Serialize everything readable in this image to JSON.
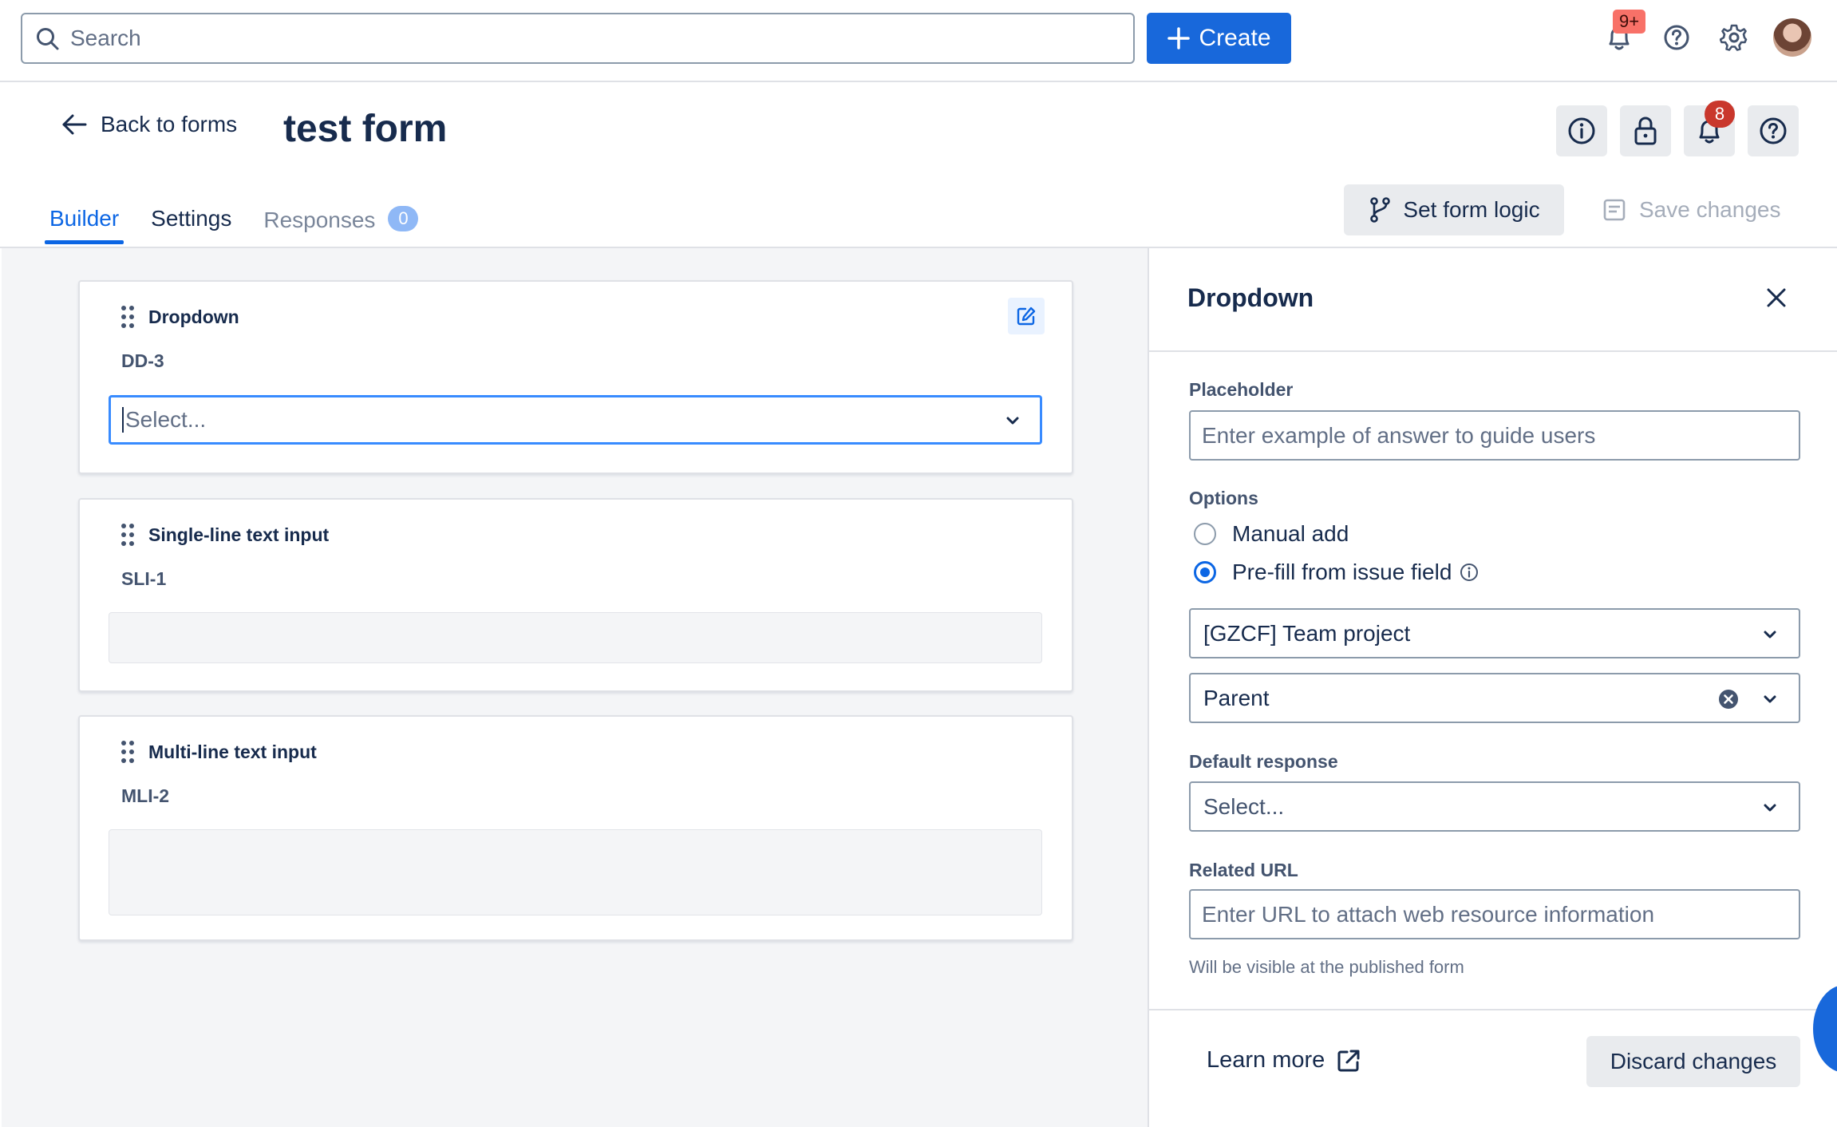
{
  "topnav": {
    "search_placeholder": "Search",
    "create_label": "Create",
    "notifications_badge": "9+",
    "icons": [
      "bell-icon",
      "help-icon",
      "gear-icon"
    ],
    "accent_color": "#1868db"
  },
  "header": {
    "back_label": "Back to forms",
    "title": "test form",
    "notifications_count": "8",
    "action_icons": [
      "info-icon",
      "lock-icon",
      "bell-icon",
      "help-icon"
    ]
  },
  "tabs": [
    {
      "label": "Builder",
      "active": true
    },
    {
      "label": "Settings",
      "active": false
    },
    {
      "label": "Responses",
      "active": false,
      "count": "0"
    }
  ],
  "toolbar": {
    "set_logic_label": "Set form logic",
    "save_label": "Save changes"
  },
  "canvas": {
    "cards": [
      {
        "label": "Dropdown",
        "code": "DD-3",
        "field_placeholder": "Select..."
      },
      {
        "label": "Single-line text input",
        "code": "SLI-1"
      },
      {
        "label": "Multi-line text input",
        "code": "MLI-2"
      }
    ]
  },
  "panel": {
    "title": "Dropdown",
    "placeholder_label": "Placeholder",
    "placeholder_input_placeholder": "Enter example of answer to guide users",
    "options_label": "Options",
    "option_manual": "Manual add",
    "option_prefill": "Pre-fill from issue field",
    "selected_option": "Pre-fill from issue field",
    "project_value": "[GZCF] Team project",
    "field_value": "Parent",
    "default_label": "Default response",
    "default_value": "Select...",
    "url_label": "Related URL",
    "url_placeholder": "Enter URL to attach web resource information",
    "url_hint": "Will be visible at the published form",
    "learn_more": "Learn more",
    "discard_label": "Discard changes"
  }
}
